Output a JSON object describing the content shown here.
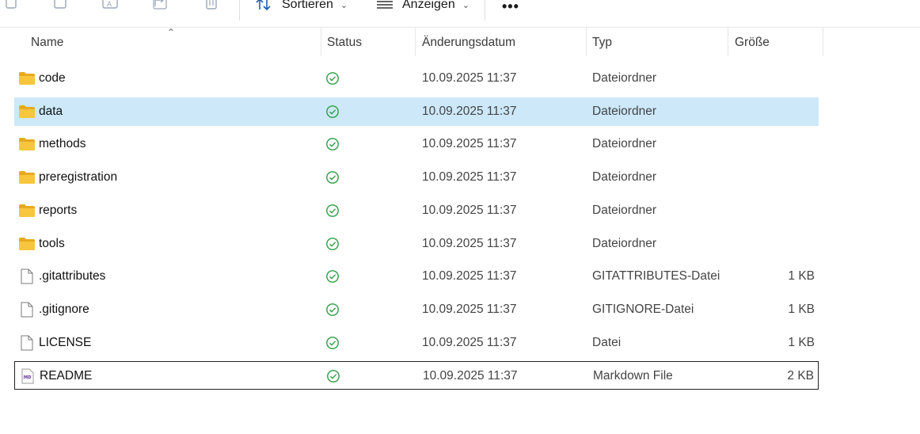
{
  "toolbar": {
    "sort_label": "Sortieren",
    "view_label": "Anzeigen",
    "more_label": "•••"
  },
  "columns": {
    "name": "Name",
    "status": "Status",
    "modified": "Änderungsdatum",
    "type": "Typ",
    "size": "Größe"
  },
  "files": [
    {
      "name": "code",
      "kind": "folder",
      "date": "10.09.2025 11:37",
      "type": "Dateiordner",
      "size": ""
    },
    {
      "name": "data",
      "kind": "folder",
      "date": "10.09.2025 11:37",
      "type": "Dateiordner",
      "size": "",
      "selected": true
    },
    {
      "name": "methods",
      "kind": "folder",
      "date": "10.09.2025 11:37",
      "type": "Dateiordner",
      "size": ""
    },
    {
      "name": "preregistration",
      "kind": "folder",
      "date": "10.09.2025 11:37",
      "type": "Dateiordner",
      "size": ""
    },
    {
      "name": "reports",
      "kind": "folder",
      "date": "10.09.2025 11:37",
      "type": "Dateiordner",
      "size": ""
    },
    {
      "name": "tools",
      "kind": "folder",
      "date": "10.09.2025 11:37",
      "type": "Dateiordner",
      "size": ""
    },
    {
      "name": ".gitattributes",
      "kind": "file",
      "date": "10.09.2025 11:37",
      "type": "GITATTRIBUTES-Datei",
      "size": "1 KB"
    },
    {
      "name": ".gitignore",
      "kind": "file",
      "date": "10.09.2025 11:37",
      "type": "GITIGNORE-Datei",
      "size": "1 KB"
    },
    {
      "name": "LICENSE",
      "kind": "file",
      "date": "10.09.2025 11:37",
      "type": "Datei",
      "size": "1 KB"
    },
    {
      "name": "README",
      "kind": "markdown",
      "date": "10.09.2025 11:37",
      "type": "Markdown File",
      "size": "2 KB",
      "focused": true
    }
  ],
  "colors": {
    "selected_bg": "#cce8f9",
    "folder_yellow": "#f8c63d",
    "status_green": "#2e9e47",
    "sort_icon_blue": "#1a5fb4"
  }
}
